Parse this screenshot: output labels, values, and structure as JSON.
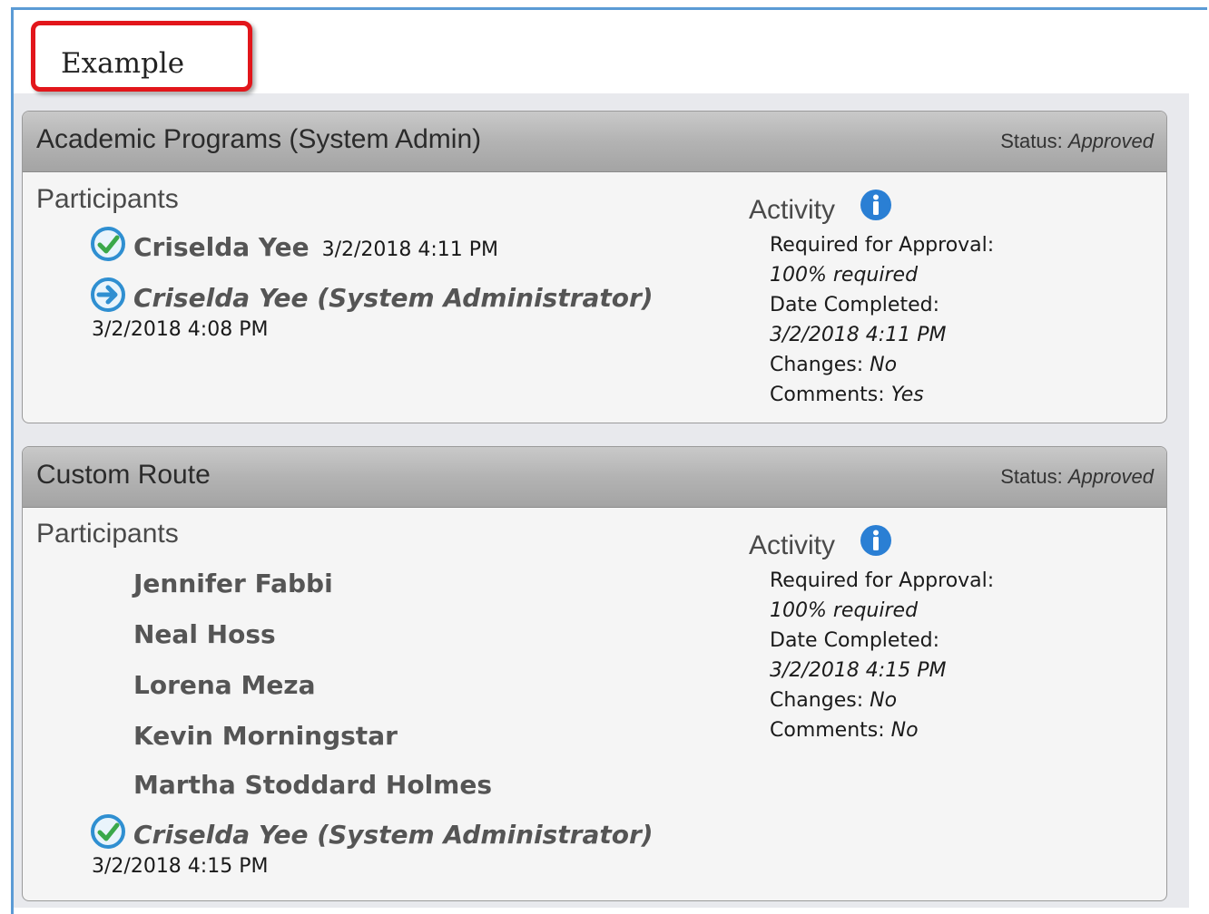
{
  "example_label": "Example",
  "panels": [
    {
      "title": "Academic Programs (System Admin)",
      "status_label": "Status:",
      "status_value": "Approved",
      "participants_heading": "Participants",
      "participants": [
        {
          "name": "Criselda Yee",
          "date": "3/2/2018 4:11 PM",
          "icon": "check-circle-icon"
        },
        {
          "name": "Criselda Yee (System Administrator)",
          "date": "3/2/2018 4:08 PM",
          "icon": "arrow-circle-icon"
        }
      ],
      "activity_heading": "Activity",
      "activity": {
        "required_label": "Required for Approval:",
        "required_value": "100% required",
        "date_label": "Date Completed:",
        "date_value": "3/2/2018 4:11 PM",
        "changes_label": "Changes:",
        "changes_value": "No",
        "comments_label": "Comments:",
        "comments_value": "Yes"
      }
    },
    {
      "title": "Custom Route",
      "status_label": "Status:",
      "status_value": "Approved",
      "participants_heading": "Participants",
      "participants": [
        {
          "name": "Jennifer Fabbi"
        },
        {
          "name": "Neal Hoss"
        },
        {
          "name": "Lorena Meza"
        },
        {
          "name": "Kevin Morningstar"
        },
        {
          "name": "Martha Stoddard Holmes"
        },
        {
          "name": "Criselda Yee (System Administrator)",
          "date": "3/2/2018 4:15 PM",
          "icon": "check-circle-icon"
        }
      ],
      "activity_heading": "Activity",
      "activity": {
        "required_label": "Required for Approval:",
        "required_value": "100% required",
        "date_label": "Date Completed:",
        "date_value": "3/2/2018 4:15 PM",
        "changes_label": "Changes:",
        "changes_value": "No",
        "comments_label": "Comments:",
        "comments_value": "No"
      }
    }
  ]
}
